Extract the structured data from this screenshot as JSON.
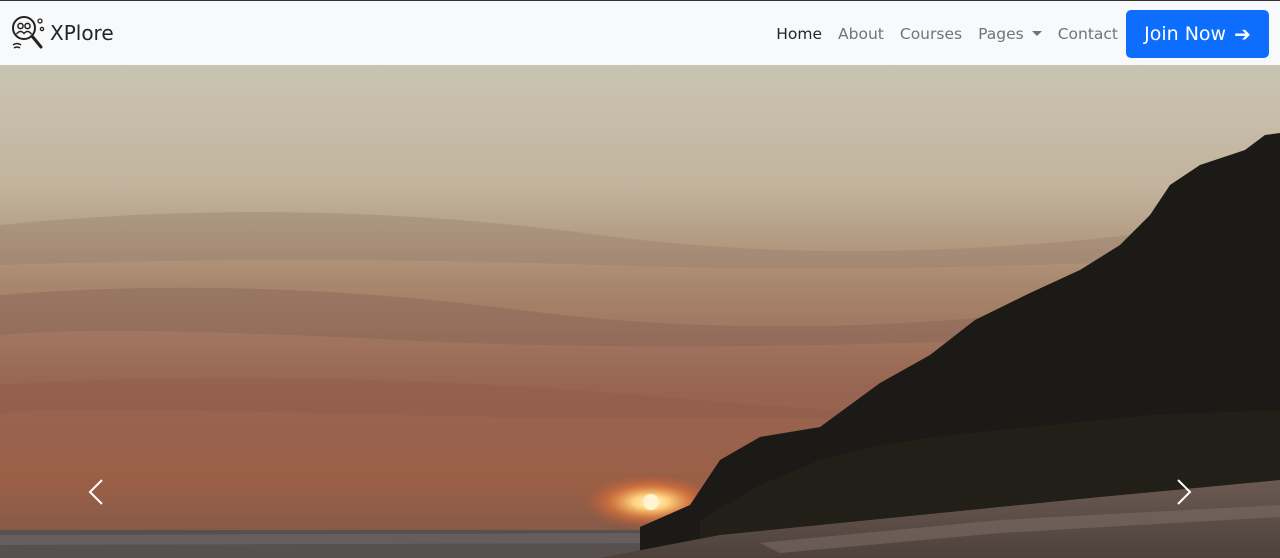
{
  "brand": {
    "name": "XPlore",
    "logo_icon": "magnifier-people-icon"
  },
  "nav": {
    "home": "Home",
    "about": "About",
    "courses": "Courses",
    "pages": "Pages",
    "contact": "Contact"
  },
  "cta": {
    "label": "Join Now",
    "arrow_icon": "arrow-right-icon",
    "color": "#0d6efd"
  },
  "carousel": {
    "prev_icon": "chevron-left-icon",
    "next_icon": "chevron-right-icon"
  }
}
